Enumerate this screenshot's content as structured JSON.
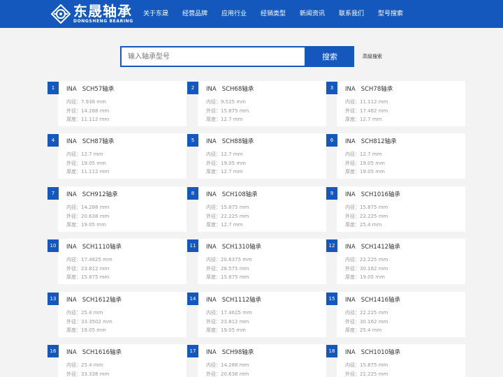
{
  "brand": {
    "name_cn": "东晟轴承",
    "name_en": "DONGSHENG BEARING",
    "color": "#1458bd"
  },
  "nav": [
    {
      "label": "关于东晟"
    },
    {
      "label": "经营品牌"
    },
    {
      "label": "应用行业"
    },
    {
      "label": "经销类型"
    },
    {
      "label": "新闻资讯"
    },
    {
      "label": "联系我们"
    },
    {
      "label": "型号搜索"
    }
  ],
  "search": {
    "placeholder": "输入轴承型号",
    "button_label": "搜索",
    "advanced_label": "高级搜索"
  },
  "spec_labels": {
    "inner": "内径：",
    "outer": "外径：",
    "width": "厚度："
  },
  "products": [
    {
      "no": "1",
      "brand": "INA",
      "model": "SCH57轴承",
      "inner": "7.938 mm",
      "outer": "14.288 mm",
      "width": "11.112 mm"
    },
    {
      "no": "2",
      "brand": "INA",
      "model": "SCH68轴承",
      "inner": "9.525 mm",
      "outer": "15.875 mm",
      "width": "12.7 mm"
    },
    {
      "no": "3",
      "brand": "INA",
      "model": "SCH78轴承",
      "inner": "11.112 mm",
      "outer": "17.462 mm",
      "width": "12.7 mm"
    },
    {
      "no": "4",
      "brand": "INA",
      "model": "SCH87轴承",
      "inner": "12.7 mm",
      "outer": "19.05 mm",
      "width": "11.112 mm"
    },
    {
      "no": "5",
      "brand": "INA",
      "model": "SCH88轴承",
      "inner": "12.7 mm",
      "outer": "19.05 mm",
      "width": "12.7 mm"
    },
    {
      "no": "6",
      "brand": "INA",
      "model": "SCH812轴承",
      "inner": "12.7 mm",
      "outer": "19.05 mm",
      "width": "19.05 mm"
    },
    {
      "no": "7",
      "brand": "INA",
      "model": "SCH912轴承",
      "inner": "14.288 mm",
      "outer": "20.638 mm",
      "width": "19.05 mm"
    },
    {
      "no": "8",
      "brand": "INA",
      "model": "SCH108轴承",
      "inner": "15.875 mm",
      "outer": "22.225 mm",
      "width": "12.7 mm"
    },
    {
      "no": "9",
      "brand": "INA",
      "model": "SCH1016轴承",
      "inner": "15.875 mm",
      "outer": "22.225 mm",
      "width": "25.4 mm"
    },
    {
      "no": "10",
      "brand": "INA",
      "model": "SCH1110轴承",
      "inner": "17.4625 mm",
      "outer": "23.812 mm",
      "width": "15.875 mm"
    },
    {
      "no": "11",
      "brand": "INA",
      "model": "SCH1310轴承",
      "inner": "20.6375 mm",
      "outer": "28.575 mm",
      "width": "15.875 mm"
    },
    {
      "no": "12",
      "brand": "INA",
      "model": "SCH1412轴承",
      "inner": "22.225 mm",
      "outer": "30.162 mm",
      "width": "19.05 mm"
    },
    {
      "no": "13",
      "brand": "INA",
      "model": "SCH1612轴承",
      "inner": "25.4 mm",
      "outer": "33.3502 mm",
      "width": "19.05 mm"
    },
    {
      "no": "14",
      "brand": "INA",
      "model": "SCH1112轴承",
      "inner": "17.4625 mm",
      "outer": "23.812 mm",
      "width": "19.05 mm"
    },
    {
      "no": "15",
      "brand": "INA",
      "model": "SCH1416轴承",
      "inner": "22.225 mm",
      "outer": "30.162 mm",
      "width": "25.4 mm"
    },
    {
      "no": "16",
      "brand": "INA",
      "model": "SCH1616轴承",
      "inner": "25.4 mm",
      "outer": "33.338 mm",
      "width": ""
    },
    {
      "no": "17",
      "brand": "INA",
      "model": "SCH98轴承",
      "inner": "14.288 mm",
      "outer": "20.638 mm",
      "width": ""
    },
    {
      "no": "18",
      "brand": "INA",
      "model": "SCH1010轴承",
      "inner": "15.875 mm",
      "outer": "22.225 mm",
      "width": ""
    }
  ]
}
